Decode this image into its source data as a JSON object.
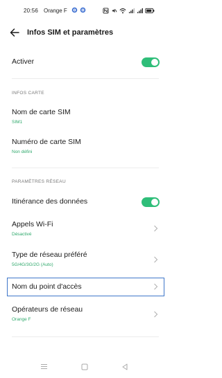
{
  "status_bar": {
    "time": "20:56",
    "carrier": "Orange F",
    "icons": [
      "settings-gear-icon",
      "settings-gear-icon",
      "nfc-icon",
      "mute-icon",
      "wifi-icon",
      "signal-icon",
      "signal-icon",
      "battery-icon"
    ]
  },
  "header": {
    "title": "Infos SIM et paramètres",
    "back_icon": "back-arrow-icon"
  },
  "activate": {
    "label": "Activer",
    "enabled": true
  },
  "sections": {
    "card_info_header": "INFOS CARTE",
    "network_params_header": "PARAMÈTRES RÉSEAU"
  },
  "card_info": {
    "sim_name_label": "Nom de carte SIM",
    "sim_name_value": "SIM1",
    "sim_number_label": "Numéro de carte SIM",
    "sim_number_value": "Non défini"
  },
  "network": {
    "roaming_label": "Itinérance des données",
    "roaming_enabled": true,
    "wifi_calls_label": "Appels Wi-Fi",
    "wifi_calls_value": "Désactivé",
    "network_type_label": "Type de réseau préféré",
    "network_type_value": "5G/4G/3G/2G (Auto)",
    "apn_label": "Nom du point d'accès",
    "operators_label": "Opérateurs de réseau",
    "operators_value": "Orange F"
  },
  "colors": {
    "accent_green": "#2fbe79",
    "highlight_blue": "#3d76c9"
  }
}
